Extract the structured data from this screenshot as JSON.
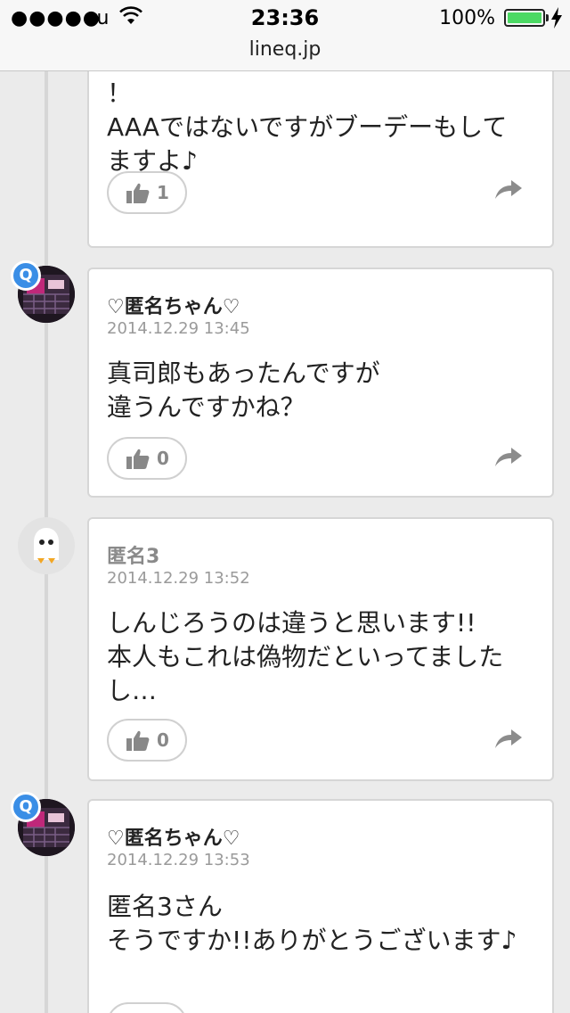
{
  "status_bar": {
    "signal": "●●●●●",
    "carrier": "au",
    "time": "23:36",
    "battery_percent": "100%"
  },
  "url_bar": {
    "domain": "lineq.jp"
  },
  "posts": [
    {
      "name": "",
      "date": "",
      "body": "！\nAAAではないですがブーデーもしてますよ♪",
      "likes": "1"
    },
    {
      "name": "♡匿名ちゃん♡",
      "date": "2014.12.29 13:45",
      "body": "真司郎もあったんですが\n違うんですかね？",
      "likes": "0"
    },
    {
      "name": "匿名3",
      "date": "2014.12.29 13:52",
      "body": "しんじろうのは違うと思います!!\n本人もこれは偽物だといってましたし…",
      "likes": "0"
    },
    {
      "name": "♡匿名ちゃん♡",
      "date": "2014.12.29 13:53",
      "body": "匿名3さん\nそうですか!!ありがとうございます♪",
      "likes": ""
    }
  ],
  "badge_letter": "Q",
  "icons": {
    "wifi": "wifi-icon",
    "charging": "charging-icon",
    "like": "thumbs-up-icon",
    "share": "share-arrow-icon"
  },
  "colors": {
    "badge": "#3a8ee6",
    "battery": "#4cd964",
    "background": "#ebebeb"
  }
}
